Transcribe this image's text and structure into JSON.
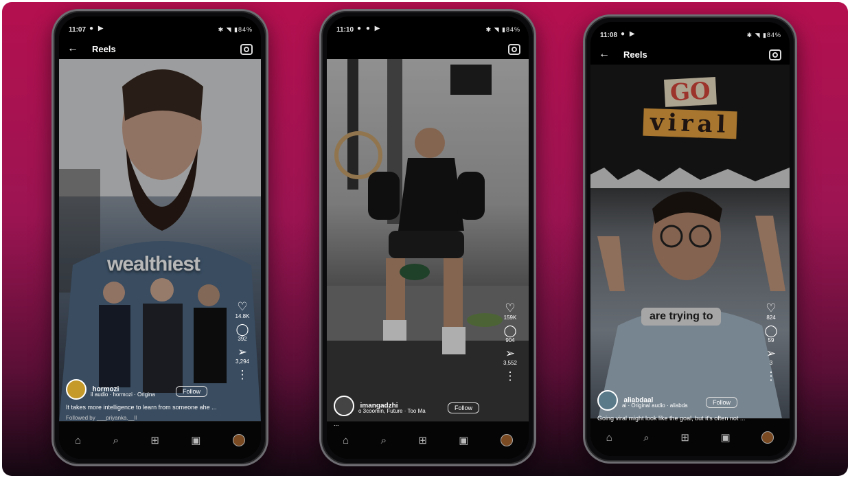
{
  "phones": [
    {
      "time": "11:07",
      "battery": "84%",
      "top_title": "Reels",
      "overlay_text": "wealthiest",
      "likes": "14.8K",
      "comments": "392",
      "shares": "3,294",
      "username": "hormozi",
      "audio": "il audio · hormozi · Origina",
      "follow_label": "Follow",
      "caption": "It takes more intelligence to learn from someone ahe ...",
      "followed_by": "Followed by ___priyanka.__ll"
    },
    {
      "time": "11:10",
      "battery": "84%",
      "likes": "159K",
      "comments": "904",
      "shares": "3,552",
      "username": "imangadzhi",
      "audio": "o 3coomin, Future · Too Ma",
      "follow_label": "Follow",
      "caption": "..."
    },
    {
      "time": "11:08",
      "battery": "84%",
      "top_title": "Reels",
      "hero_go": "GO",
      "hero_viral": "viral",
      "overlay_text": "are trying to",
      "likes": "824",
      "comments": "59",
      "shares": "3",
      "username": "aliabdaal",
      "audio": "ai · Original audio · aliabda",
      "follow_label": "Follow",
      "caption": "Going viral might look like the goal, but it's often not ..."
    }
  ],
  "icons": {
    "back": "←",
    "heart": "♡",
    "comment": "◯",
    "share": "➢",
    "more": "⋮",
    "home": "⌂",
    "search": "⌕",
    "add": "⊞",
    "reels": "▣"
  }
}
